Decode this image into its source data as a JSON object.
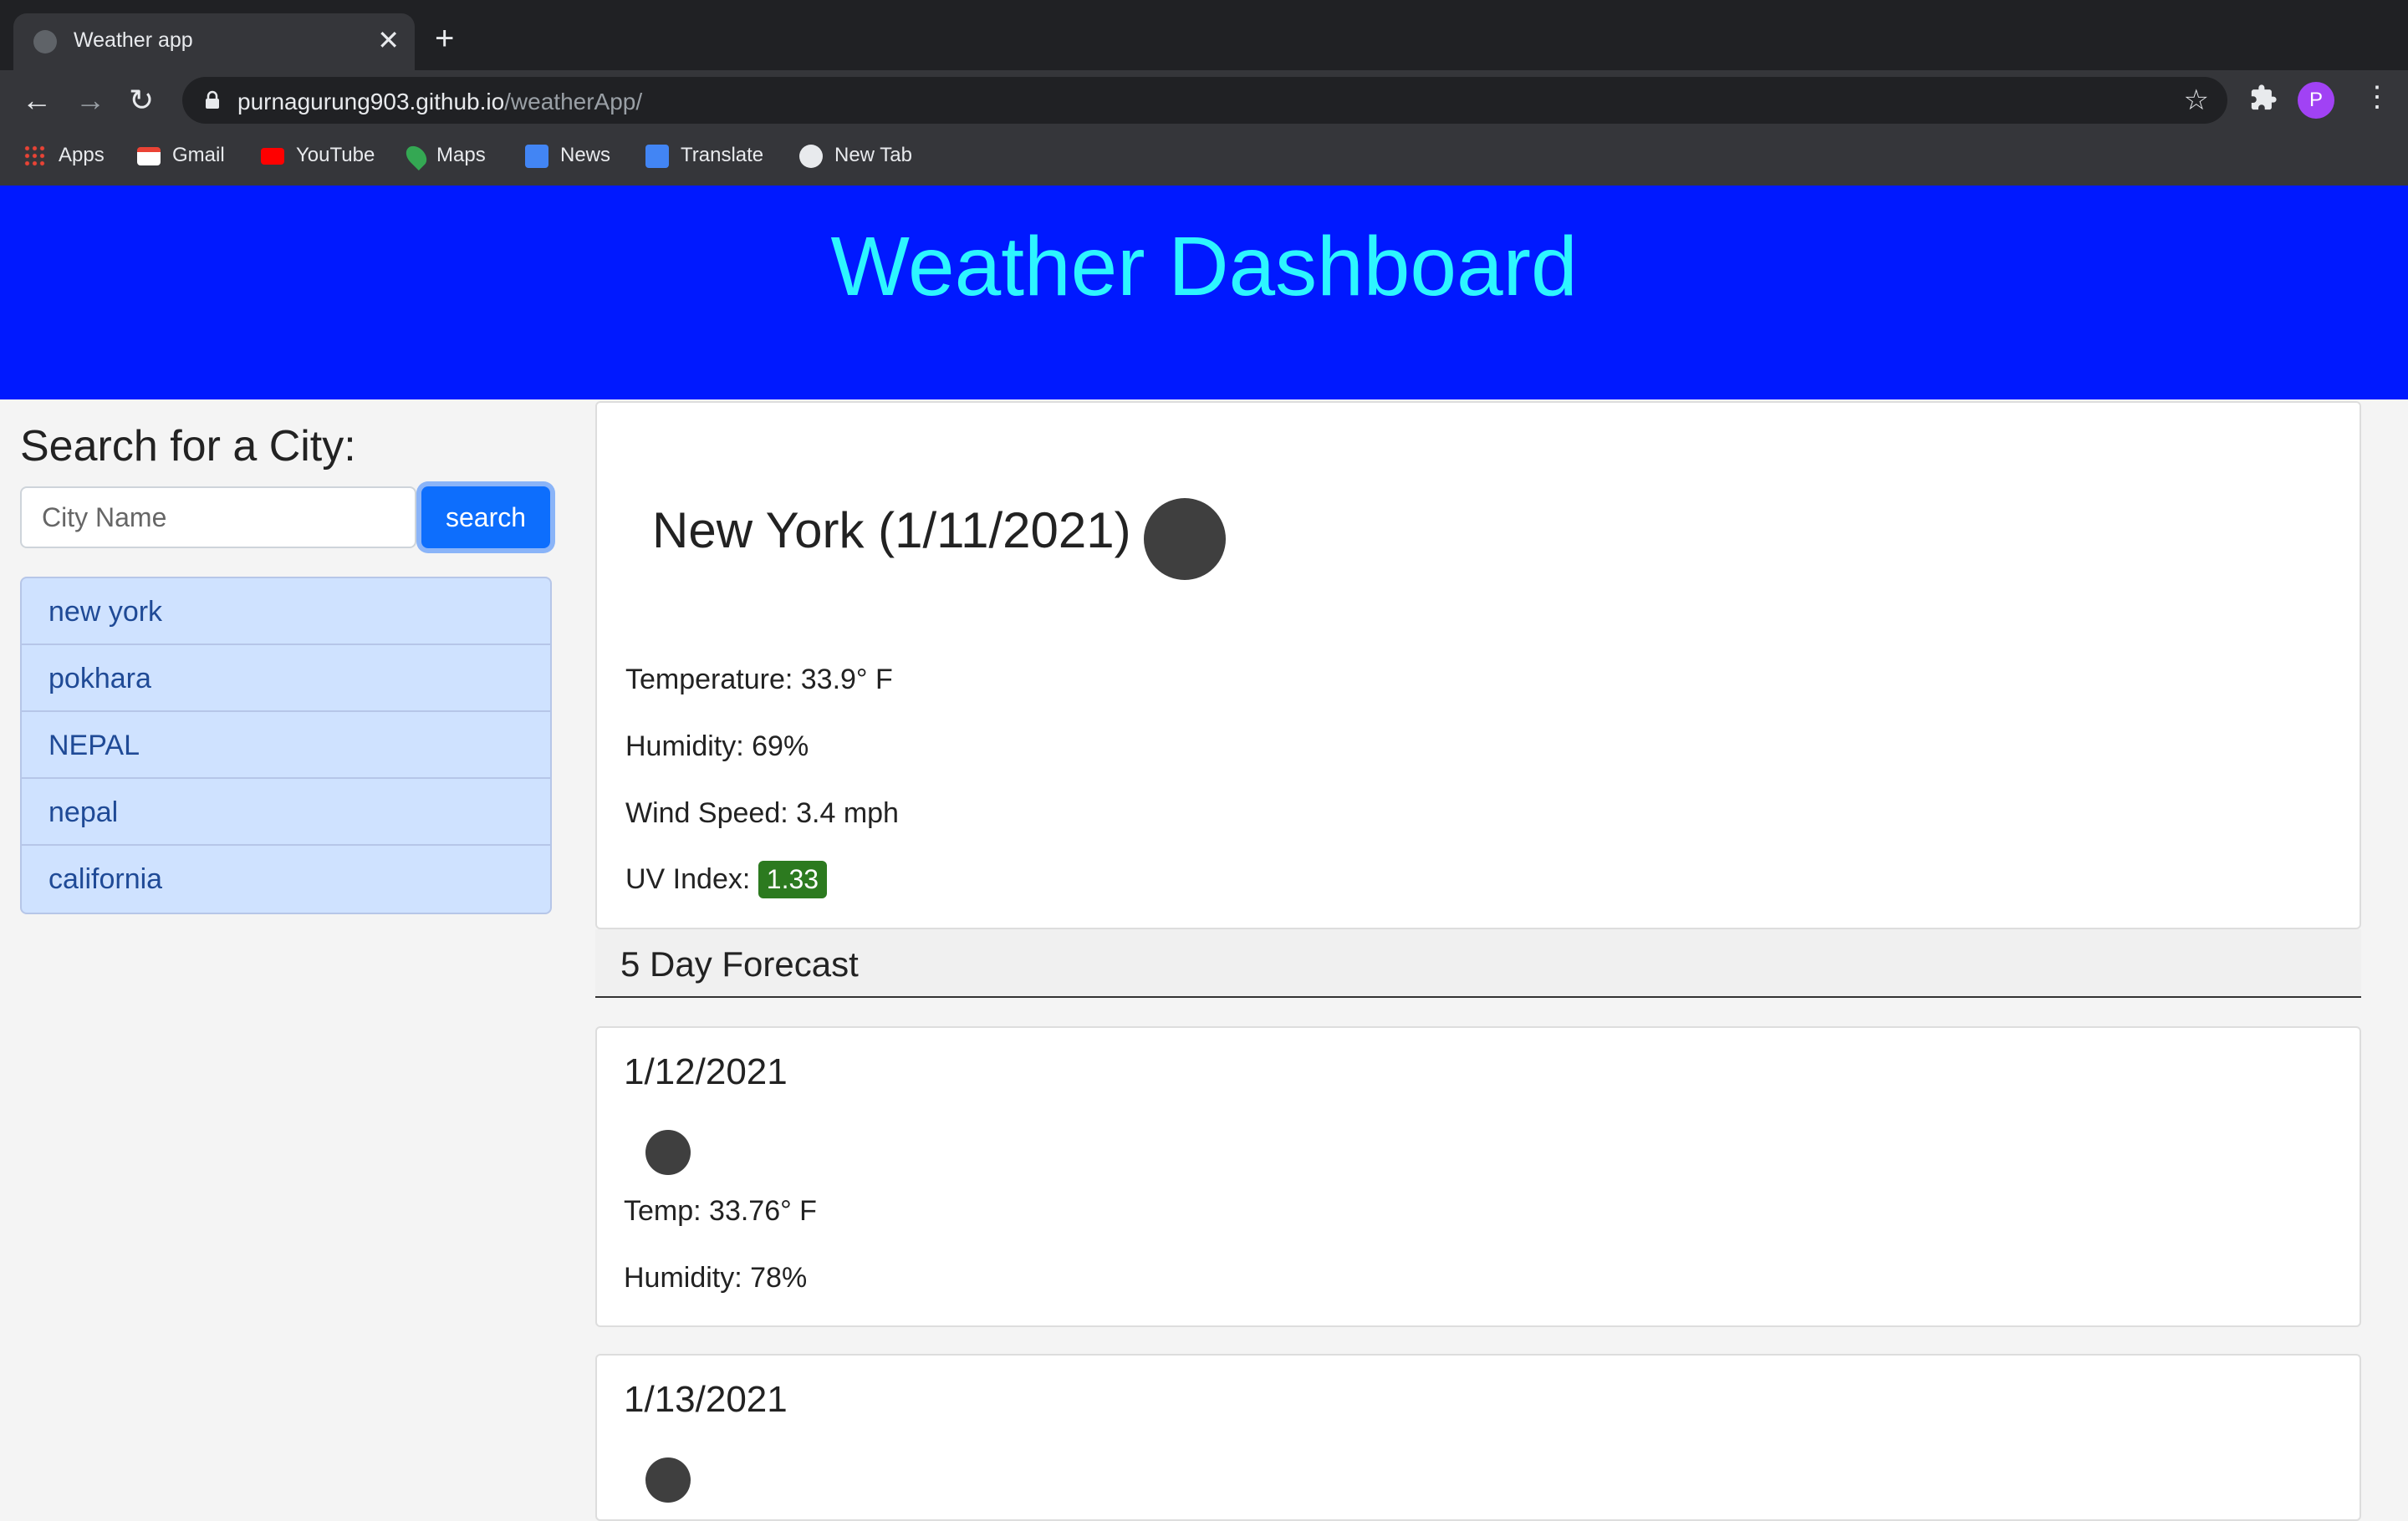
{
  "browser": {
    "tab_title": "Weather app",
    "url_host": "purnagurung903.github.io",
    "url_path": "/weatherApp/",
    "profile_initial": "P",
    "bookmarks": [
      {
        "label": "Apps",
        "icon": "apps-grid-icon",
        "color": "#ea4335"
      },
      {
        "label": "Gmail",
        "icon": "gmail-icon",
        "color": "#ea4335"
      },
      {
        "label": "YouTube",
        "icon": "youtube-icon",
        "color": "#ff0000"
      },
      {
        "label": "Maps",
        "icon": "maps-pin-icon",
        "color": "#34a853"
      },
      {
        "label": "News",
        "icon": "news-icon",
        "color": "#4285f4"
      },
      {
        "label": "Translate",
        "icon": "translate-icon",
        "color": "#4285f4"
      },
      {
        "label": "New Tab",
        "icon": "globe-icon",
        "color": "#e8eaed"
      }
    ]
  },
  "header": {
    "title": "Weather Dashboard"
  },
  "search": {
    "title": "Search for a City:",
    "placeholder": "City Name",
    "button_label": "search",
    "history": [
      "new york",
      "pokhara",
      "NEPAL",
      "nepal",
      "california"
    ]
  },
  "current": {
    "city_date": "New York (1/11/2021)",
    "temperature": "Temperature: 33.9° F",
    "humidity": "Humidity: 69%",
    "wind": "Wind Speed: 3.4 mph",
    "uv_label": "UV Index:",
    "uv_value": "1.33",
    "uv_color": "#2c7a1f"
  },
  "forecast": {
    "title": "5 Day Forecast",
    "days": [
      {
        "date": "1/12/2021",
        "temp": "Temp: 33.76° F",
        "humidity": "Humidity: 78%"
      },
      {
        "date": "1/13/2021"
      }
    ]
  }
}
